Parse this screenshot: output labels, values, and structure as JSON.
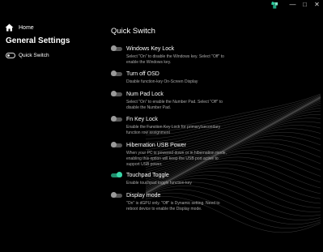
{
  "titlebar": {
    "logo_icon": "app-logo-icon",
    "minimize": "—",
    "maximize": "□",
    "close": "✕"
  },
  "sidebar": {
    "home_label": "Home",
    "title": "General Settings",
    "item_label": "Quick Switch"
  },
  "main": {
    "title": "Quick Switch",
    "settings": [
      {
        "label": "Windows Key Lock",
        "on": false,
        "desc_lines": [
          "Select \"On\" to disable the Windows key. Select \"Off\" to",
          "enable the Windows key."
        ]
      },
      {
        "label": "Turn off OSD",
        "on": false,
        "desc_lines": [
          "Disable function-key On-Screen Display"
        ]
      },
      {
        "label": "Num Pad Lock",
        "on": false,
        "desc_lines": [
          "Select \"On\" to enable the Number Pad. Select \"Off\" to",
          "disable the Number Pad."
        ]
      },
      {
        "label": "Fn Key Lock",
        "on": false,
        "desc_lines": [
          "Enable the Function Key Lock for primary/secondary",
          "function row assignment"
        ]
      },
      {
        "label": "Hibernation USB Power",
        "on": false,
        "desc_lines": [
          "When your PC is powered down or in hibernation mode,",
          "enabling this option will keep the USB port active to",
          "support USB power."
        ]
      },
      {
        "label": "Touchpad Toggle",
        "on": true,
        "desc_lines": [
          "Enable touchpad toggle function-key"
        ]
      },
      {
        "label": "Display mode",
        "on": false,
        "desc_lines": [
          "\"On\" is dGPU only. \"Off\" is Dynamic setting. Need to",
          "reboot device to enable the Display mode."
        ]
      }
    ]
  },
  "colors": {
    "background": "#000000",
    "toggle_on": "#39d6a8",
    "toggle_off": "#9a9a9a"
  }
}
